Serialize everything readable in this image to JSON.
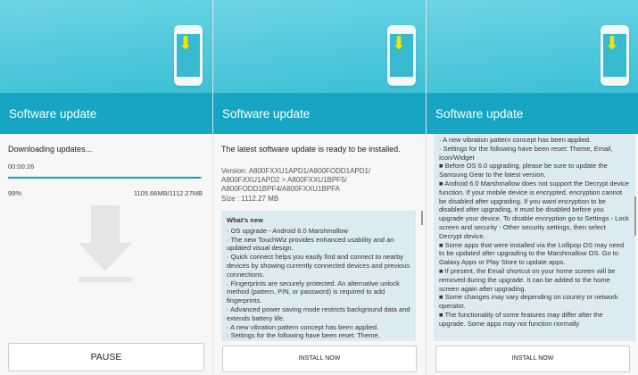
{
  "header": {
    "title": "Software update"
  },
  "panel1": {
    "status": "Downloading updates...",
    "elapsed": "00:00:26",
    "progress_percent": 99,
    "percent_label": "99%",
    "size_label": "1105.66MB/1112.27MB",
    "button_label": "PAUSE"
  },
  "panel2": {
    "ready_text": "The latest software update is ready to be installed.",
    "version_line1": "Version: A800FXXU1APD1/A800FODD1APD1/",
    "version_line2": "A800FXXU1APD2 > A800FXXU1BPF5/",
    "version_line3": "A800FODD1BPF4/A800FXXU1BPFA",
    "size": "Size : 1112.27 MB",
    "whats_new_title": "What's new",
    "notes": [
      "· OS upgrade - Android 6.0 Marshmallow",
      "· The new TouchWiz provides enhanced usability and an updated visual design.",
      "· Quick connect helps you easily find and connect to nearby devices by showing currently connected devices and previous connections.",
      "· Fingerprints are securely protected. An alternative unlock method (pattern, PIN, or password) is required to add fingerprints.",
      "· Advanced power saving mode restricts background data and extends battery life.",
      "· A new vibration pattern concept has been applied.",
      "· Settings for the following have been reset: Theme,"
    ],
    "button_label": "INSTALL NOW"
  },
  "panel3": {
    "notes": [
      "· A new vibration pattern concept has been applied.",
      "· Settings for the following have been reset: Theme, Email, Icon/Widget",
      "■ Before OS 6.0 upgrading, please be sure to update the Samsung Gear to the latest version.",
      "■ Android 6.0 Marshmallow does not support the Decrypt device function. If your mobile device is encrypted, encryption cannot be disabled after upgrading. If you want encryption to be disabled after upgrading, it must be disabled before you upgrade your device. To disable encryption go to Settings - Lock screen and security - Other security settings, then select Decrypt device.",
      "■ Some apps that were installed via the Lollipop OS may need to be updated after upgrading to the Marshmallow OS. Go to Galaxy Apps or Play Store to update apps.",
      "■ If present, the Email shortcut on your home screen will be removed during the upgrade. It can be added to the home screen again after upgrading.",
      "■ Some changes may vary depending on country or network operator.",
      "■ The functionality of some features may differ after the upgrade. Some apps may not function normally"
    ],
    "button_label": "INSTALL NOW"
  },
  "icons": {
    "download": "download-arrow-icon"
  },
  "colors": {
    "hero": "#3ec0d6",
    "title_bar": "#16a5c2",
    "progress": "#0fa2c0",
    "notes_bg": "#dcebf1",
    "arrow": "#f5e400"
  }
}
